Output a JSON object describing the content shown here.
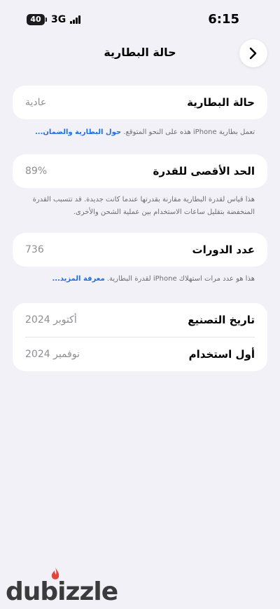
{
  "status_bar": {
    "battery": "40",
    "network": "3G",
    "time": "6:15"
  },
  "nav": {
    "title": "حالة البطارية",
    "back_icon": "chevron-right-icon"
  },
  "battery_health": {
    "label": "حالة البطارية",
    "value": "عادية",
    "footnote": "تعمل بطارية iPhone هذه على النحو المتوقع.",
    "footnote_link": "حول البطارية والضمان..."
  },
  "max_capacity": {
    "label": "الحد الأقصى للقدرة",
    "value": "89%",
    "footnote": "هذا قياس لقدرة البطارية مقارنة بقدرتها عندما كانت جديدة. قد تتسبب القدرة المنخفضة بتقليل ساعات الاستخدام بين عملية الشحن والأخرى."
  },
  "cycle_count": {
    "label": "عدد الدورات",
    "value": "736",
    "footnote": "هذا هو عدد مرات استهلاك iPhone لقدرة البطارية.",
    "footnote_link": "معرفة المزيد..."
  },
  "dates": {
    "manufacture_label": "تاريخ التصنيع",
    "manufacture_value": "أكتوبر 2024",
    "first_use_label": "أول استخدام",
    "first_use_value": "نوفمبر 2024"
  },
  "watermark": {
    "text": "dubizzle"
  },
  "colors": {
    "background": "#f2f1f7",
    "card": "#ffffff",
    "link": "#1f6fe0",
    "secondary_text": "#8e8e93"
  }
}
